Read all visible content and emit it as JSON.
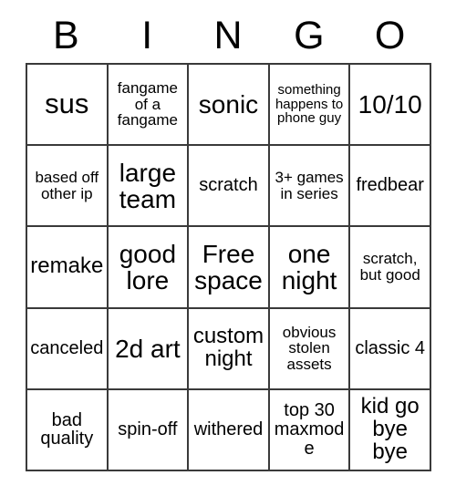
{
  "card": {
    "header_letters": [
      "B",
      "I",
      "N",
      "G",
      "O"
    ],
    "columns": 5,
    "rows": 5,
    "background_color": "#ffffff",
    "border_color": "#3a3a3a",
    "text_color": "#000000",
    "free_space_label": "Free space",
    "free_space_position": {
      "row": 3,
      "column": 3
    },
    "rows_data": [
      [
        "sus",
        "fangame of a fangame",
        "sonic",
        "something happens to phone guy",
        "10/10"
      ],
      [
        "based off other ip",
        "large team",
        "scratch",
        "3+ games in series",
        "fredbear"
      ],
      [
        "remake",
        "good lore",
        "Free space",
        "one night",
        "scratch, but good"
      ],
      [
        "canceled",
        "2d art",
        "custom night",
        "obvious stolen assets",
        "classic 4"
      ],
      [
        "bad quality",
        "spin-off",
        "withered",
        "top 30 maxmode",
        "kid go bye bye"
      ]
    ]
  }
}
